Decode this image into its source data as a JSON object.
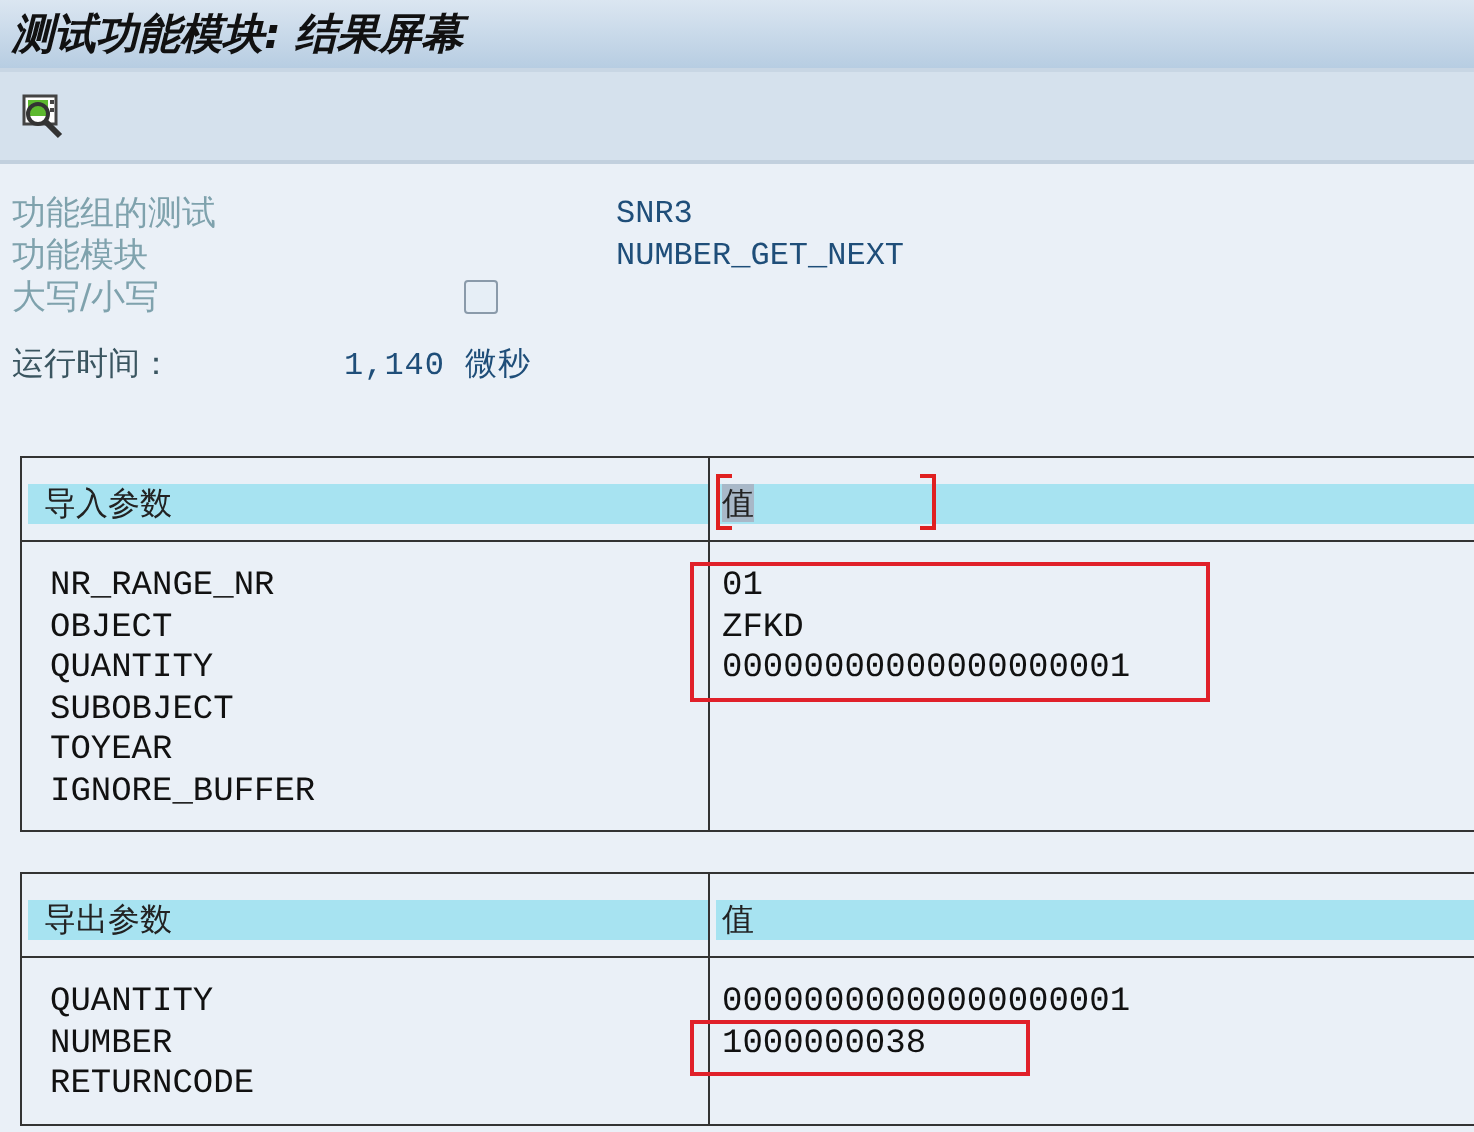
{
  "title": "测试功能模块: 结果屏幕",
  "info": [
    {
      "kind": "text",
      "label": "功能组的测试",
      "value": "SNR3"
    },
    {
      "kind": "text",
      "label": "功能模块",
      "value": "NUMBER_GET_NEXT"
    },
    {
      "kind": "checkbox",
      "label": "大写/小写",
      "checked": false
    }
  ],
  "runtime": {
    "label": "运行时间：",
    "value": "1,140 微秒"
  },
  "tables": [
    {
      "name_header": "导入参数",
      "value_header": "值",
      "header_marked": true,
      "rows": [
        {
          "name": "NR_RANGE_NR",
          "value": "01",
          "boxed": true
        },
        {
          "name": "OBJECT",
          "value": "ZFKD",
          "boxed": true
        },
        {
          "name": "QUANTITY",
          "value": "00000000000000000001",
          "boxed": true
        },
        {
          "name": "SUBOBJECT",
          "value": "",
          "boxed": false
        },
        {
          "name": "TOYEAR",
          "value": "",
          "boxed": false
        },
        {
          "name": "IGNORE_BUFFER",
          "value": "",
          "boxed": false
        }
      ]
    },
    {
      "name_header": "导出参数",
      "value_header": "值",
      "header_marked": false,
      "rows": [
        {
          "name": "QUANTITY",
          "value": "00000000000000000001",
          "boxed": false
        },
        {
          "name": "NUMBER",
          "value": "1000000038",
          "boxed": true
        },
        {
          "name": "RETURNCODE",
          "value": "",
          "boxed": false
        }
      ]
    }
  ]
}
